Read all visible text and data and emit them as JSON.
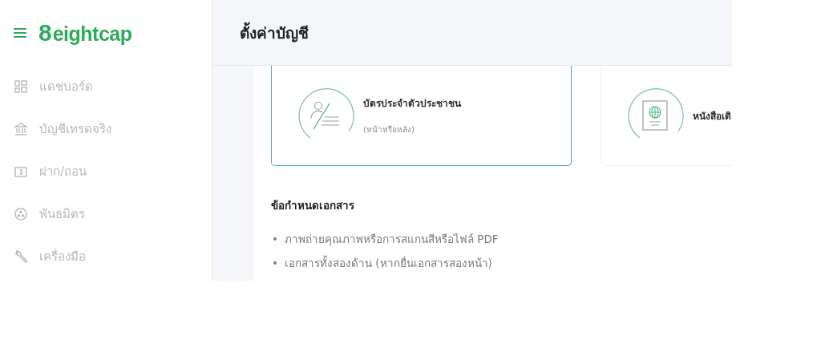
{
  "logo": {
    "mark": "8",
    "text": "eightcap"
  },
  "sidebar": {
    "items": [
      {
        "label": "แดชบอร์ด",
        "kind": "grid"
      },
      {
        "label": "บัญชีเทรดจริง",
        "kind": "bank"
      },
      {
        "label": "ฝาก/ถอน",
        "kind": "money"
      },
      {
        "label": "พันธมิตร",
        "kind": "partner"
      },
      {
        "label": "เครื่องมือ",
        "kind": "tool"
      }
    ]
  },
  "header": {
    "title": "ตั้งค่าบัญชี"
  },
  "documents": [
    {
      "title": "บัตรประจำตัวประชาชน",
      "subtitle": "(หน้าหรือหลัง)",
      "kind": "id",
      "selected": true
    },
    {
      "title": "หนังสือเดิ",
      "kind": "passport",
      "selected": false
    }
  ],
  "requirements": {
    "title": "ข้อกำหนดเอกสาร",
    "items": [
      "ภาพถ่ายคุณภาพหรือการสแกนสีหรือไฟล์ PDF",
      "เอกสารทั้งสองด้าน (หากยื่นเอกสารสองหน้า)"
    ]
  }
}
